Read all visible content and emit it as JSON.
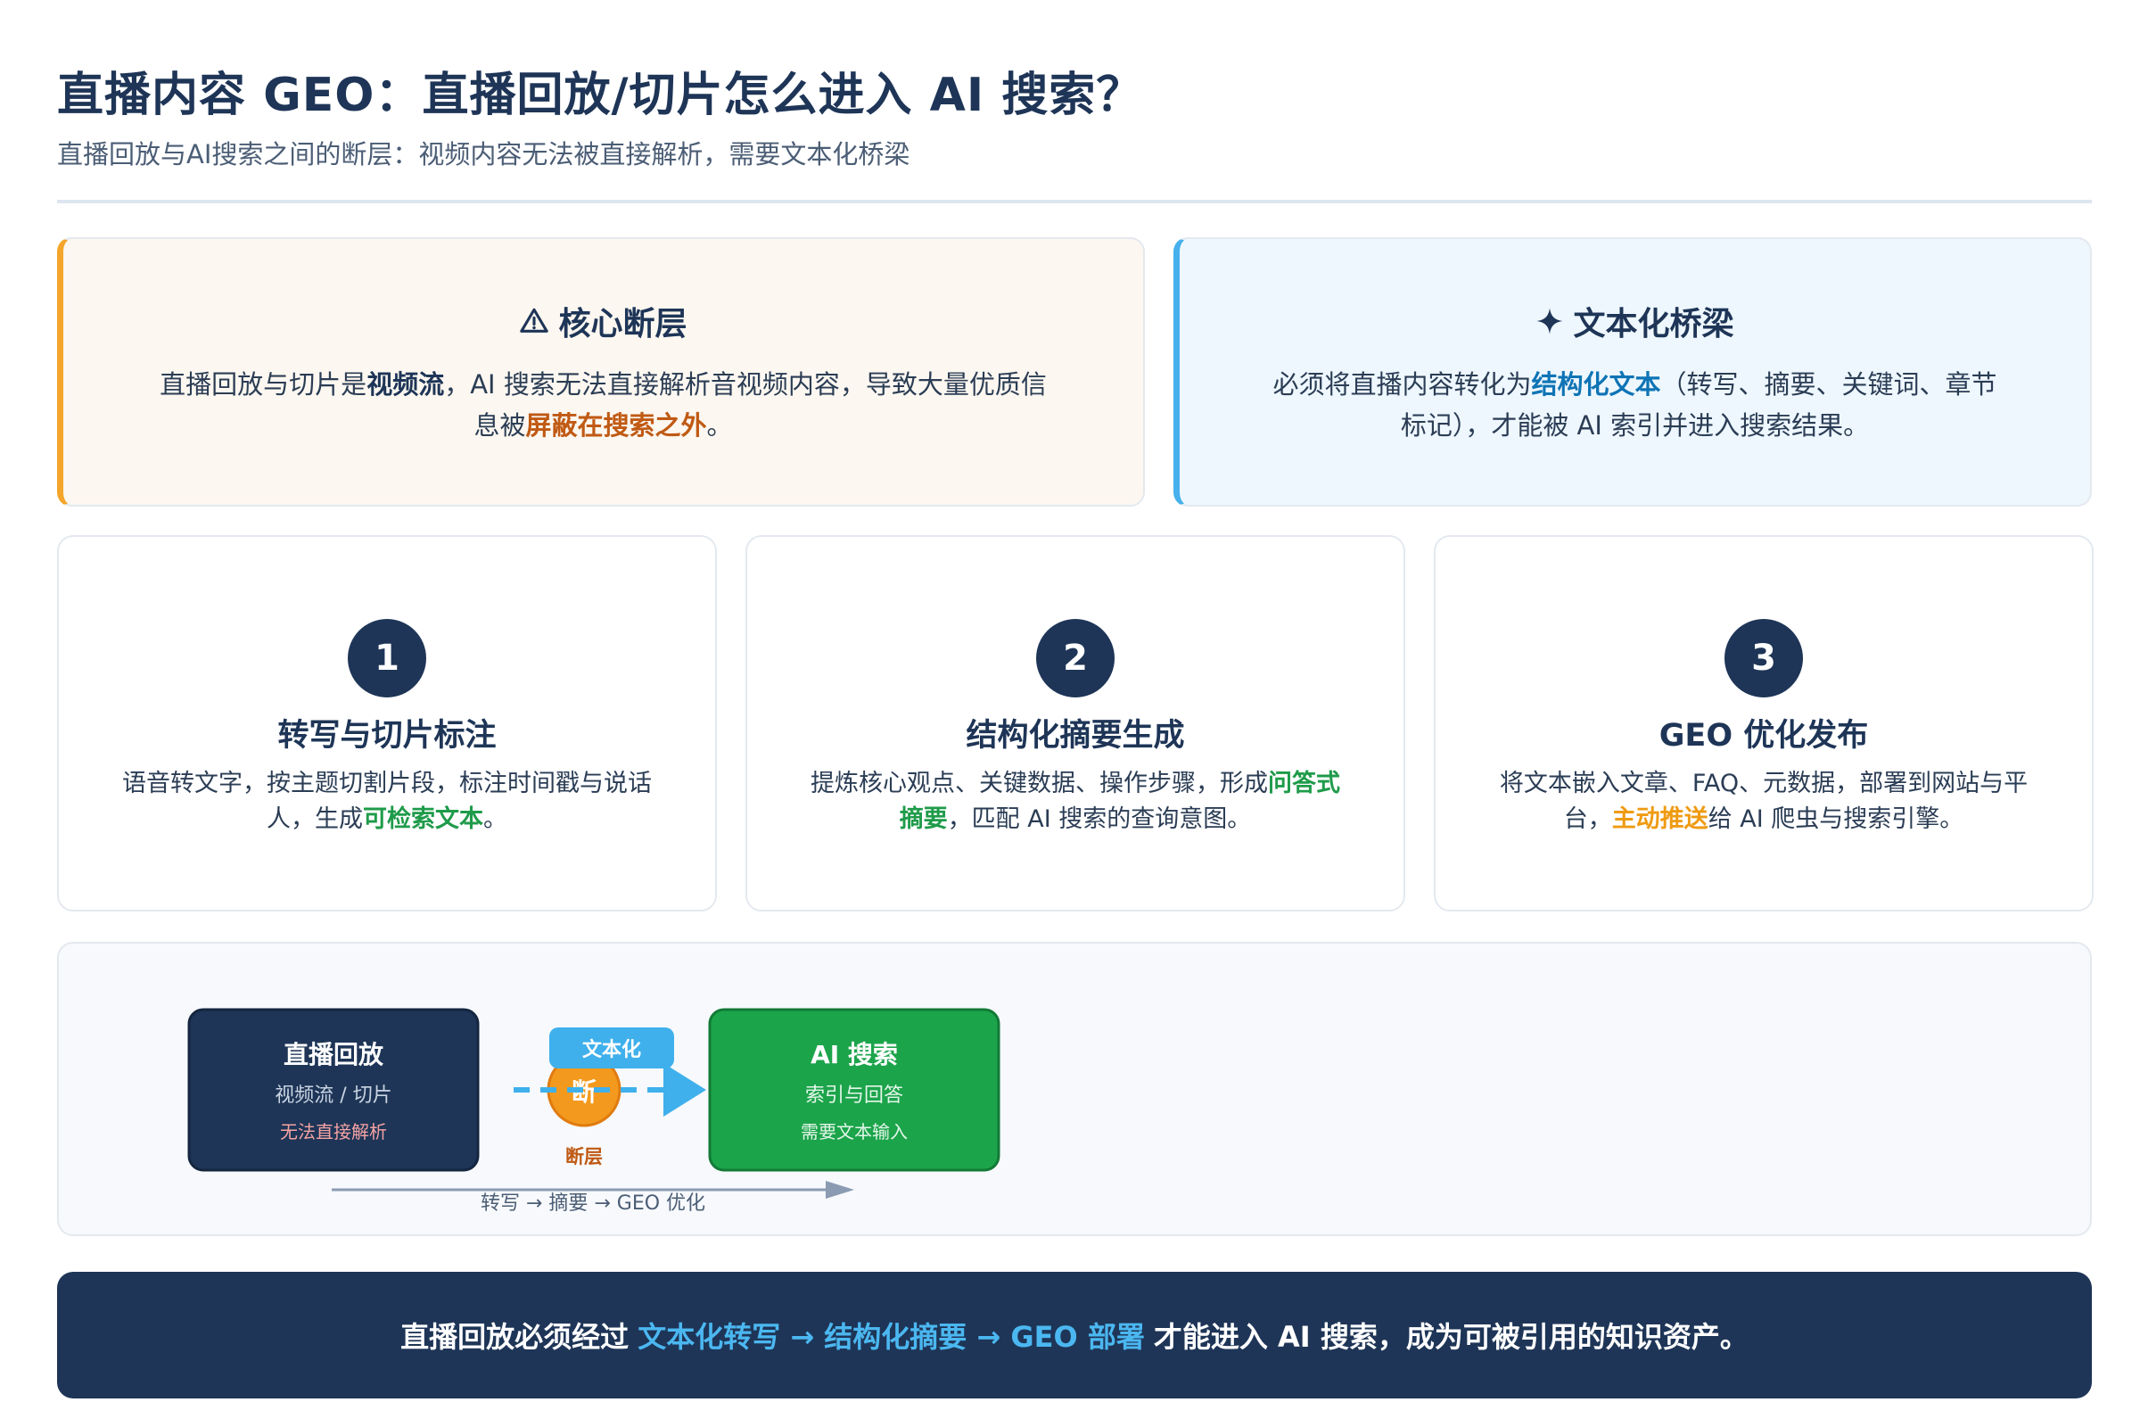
{
  "header": {
    "title": "直播内容 GEO：直播回放/切片怎么进入 AI 搜索？",
    "subtitle": "直播回放与AI搜索之间的断层：视频内容无法被直接解析，需要文本化桥梁"
  },
  "gap_card": {
    "icon": "warning-triangle-icon",
    "title": "核心断层",
    "text_1": "直播回放与切片是",
    "strong_1": "视频流",
    "text_2": "，AI 搜索无法直接解析音视频内容，导致大量优质信息被",
    "strong_2": "屏蔽在搜索之外",
    "text_3": "。",
    "accent": "#f4a52b"
  },
  "bridge_card": {
    "icon": "sparkle-icon",
    "title": "文本化桥梁",
    "text_1": "必须将直播内容转化为",
    "strong_1": "结构化文本",
    "text_2": "（转写、摘要、关键词、章节标记），才能被 AI 索引并进入搜索结果。",
    "accent": "#46b1ec"
  },
  "steps": [
    {
      "number": "1",
      "title": "转写与切片标注",
      "text_1": "语音转文字，按主题切割片段，标注时间戳与说话人，生成",
      "strong": "可检索文本",
      "text_2": "。"
    },
    {
      "number": "2",
      "title": "结构化摘要生成",
      "text_1": "提炼核心观点、关键数据、操作步骤，形成",
      "strong": "问答式摘要",
      "text_2": "，匹配 AI 搜索的查询意图。"
    },
    {
      "number": "3",
      "title": "GEO 优化发布",
      "text_1": "将文本嵌入文章、FAQ、元数据，部署到网站与平台，",
      "strong": "主动推送",
      "text_2": "给 AI 爬虫与搜索引擎。"
    }
  ],
  "diagram": {
    "source": {
      "title": "直播回放",
      "line_1": "视频流 / 切片",
      "line_2": "无法直接解析",
      "color": "#1e3557"
    },
    "gap": {
      "badge": "文本化",
      "circle": "断",
      "caption": "断层",
      "color": "#f39a1e"
    },
    "target": {
      "title": "AI 搜索",
      "line_1": "索引与回答",
      "line_2": "需要文本输入",
      "color": "#1ca44b"
    },
    "pipeline": "转写 → 摘要 → GEO 优化"
  },
  "banner": {
    "text_1": "直播回放必须经过",
    "highlight": "文本化转写 → 结构化摘要 → GEO 部署",
    "text_2": "才能进入 AI 搜索，成为可被引用的知识资产。"
  }
}
